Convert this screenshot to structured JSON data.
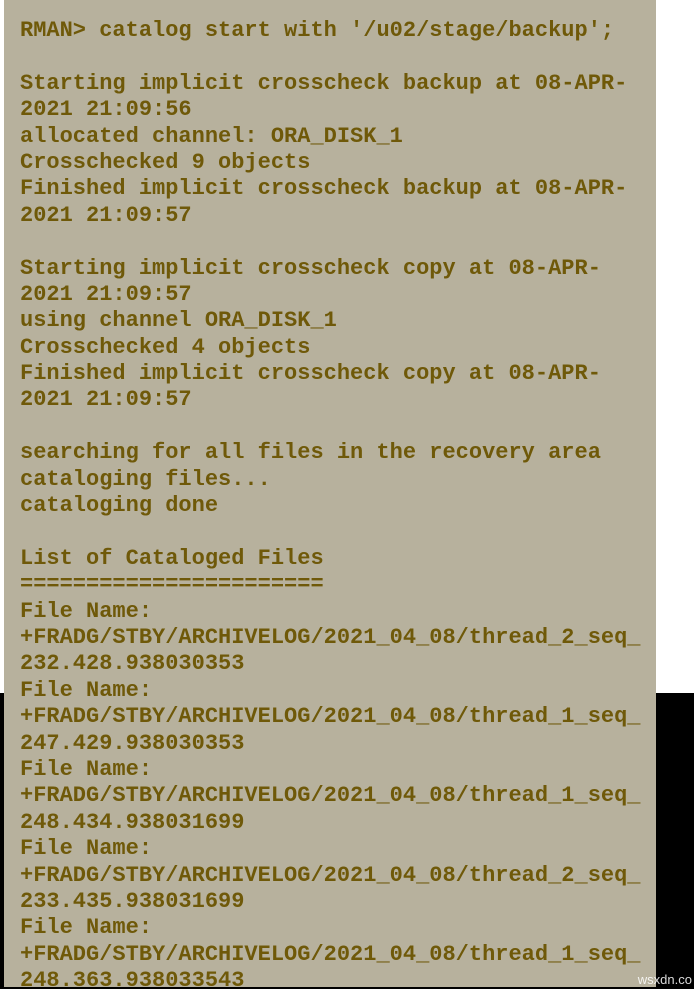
{
  "terminal": {
    "prompt_line": "RMAN> catalog start with '/u02/stage/backup';",
    "blank1": "",
    "line_start_backup": "Starting implicit crosscheck backup at 08-APR-2021 21:09:56",
    "line_alloc_channel": "allocated channel: ORA_DISK_1",
    "line_crosschecked9": "Crosschecked 9 objects",
    "line_finish_backup": "Finished implicit crosscheck backup at 08-APR-2021 21:09:57",
    "blank2": "",
    "line_start_copy": "Starting implicit crosscheck copy at 08-APR-2021 21:09:57",
    "line_using_channel": "using channel ORA_DISK_1",
    "line_crosschecked4": "Crosschecked 4 objects",
    "line_finish_copy": "Finished implicit crosscheck copy at 08-APR-2021 21:09:57",
    "blank3": "",
    "line_searching": "searching for all files in the recovery area",
    "line_cataloging": "cataloging files...",
    "line_done": "cataloging done",
    "blank4": "",
    "line_list_header": "List of Cataloged Files",
    "line_separator": "=======================",
    "file1_label": "File Name: ",
    "file1_path": "+FRADG/STBY/ARCHIVELOG/2021_04_08/thread_2_seq_232.428.938030353",
    "file2_label": "File Name: ",
    "file2_path": "+FRADG/STBY/ARCHIVELOG/2021_04_08/thread_1_seq_247.429.938030353",
    "file3_label": "File Name: ",
    "file3_path": "+FRADG/STBY/ARCHIVELOG/2021_04_08/thread_1_seq_248.434.938031699",
    "file4_label": "File Name: ",
    "file4_path": "+FRADG/STBY/ARCHIVELOG/2021_04_08/thread_2_seq_233.435.938031699",
    "file5_label": "File Name: ",
    "file5_path": "+FRADG/STBY/ARCHIVELOG/2021_04_08/thread_1_seq_248.363.938033543"
  },
  "watermark": "wsxdn.co"
}
